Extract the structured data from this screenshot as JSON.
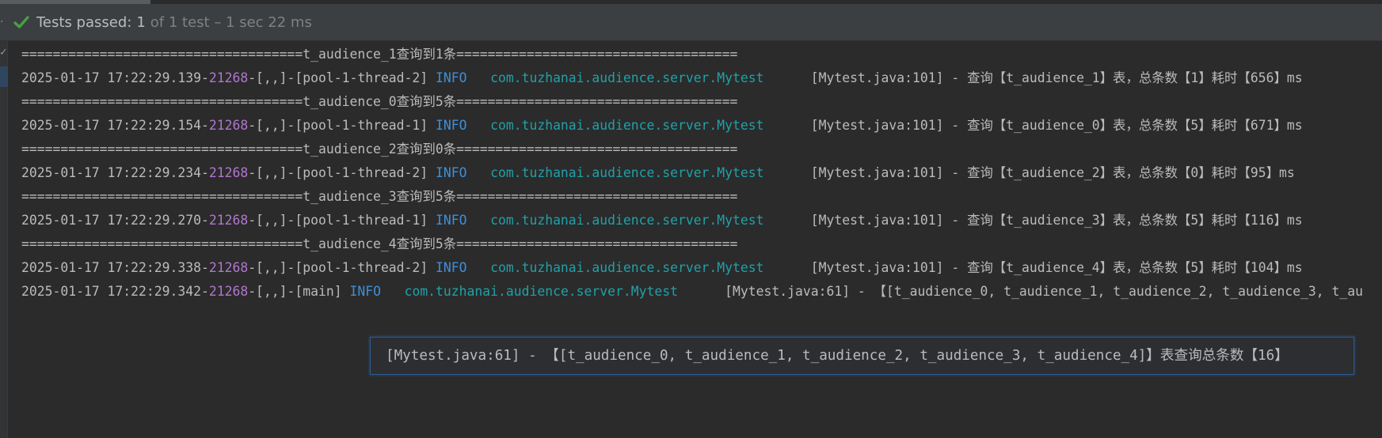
{
  "status": {
    "check_icon": "check-icon",
    "label": "Tests passed:",
    "count": "1",
    "rest": "of 1 test – 1 sec 22 ms",
    "colors": {
      "check": "#4a9e46",
      "bg": "#3c3f41"
    }
  },
  "colors": {
    "pid": "#b276d0",
    "info": "#3f8ed8",
    "class": "#1fa1a8",
    "text": "#bbbbbb",
    "tooltip_border": "#2c5a8e"
  },
  "console": {
    "lines": [
      {
        "type": "sep",
        "text": "====================================t_audience_1查询到1条===================================="
      },
      {
        "type": "log",
        "prefix": "2025-01-17 17:22:29.139-",
        "pid": "21268",
        "thread": "-[,,]-[pool-1-thread-2] ",
        "level": "INFO",
        "gap": "   ",
        "cls": "com.tuzhanai.audience.server.Mytest",
        "msg": "      [Mytest.java:101] - 查询【t_audience_1】表，总条数【1】耗时【656】ms"
      },
      {
        "type": "sep",
        "text": "====================================t_audience_0查询到5条===================================="
      },
      {
        "type": "log",
        "prefix": "2025-01-17 17:22:29.154-",
        "pid": "21268",
        "thread": "-[,,]-[pool-1-thread-1] ",
        "level": "INFO",
        "gap": "   ",
        "cls": "com.tuzhanai.audience.server.Mytest",
        "msg": "      [Mytest.java:101] - 查询【t_audience_0】表，总条数【5】耗时【671】ms"
      },
      {
        "type": "sep",
        "text": "====================================t_audience_2查询到0条===================================="
      },
      {
        "type": "log",
        "prefix": "2025-01-17 17:22:29.234-",
        "pid": "21268",
        "thread": "-[,,]-[pool-1-thread-2] ",
        "level": "INFO",
        "gap": "   ",
        "cls": "com.tuzhanai.audience.server.Mytest",
        "msg": "      [Mytest.java:101] - 查询【t_audience_2】表，总条数【0】耗时【95】ms"
      },
      {
        "type": "sep",
        "text": "====================================t_audience_3查询到5条===================================="
      },
      {
        "type": "log",
        "prefix": "2025-01-17 17:22:29.270-",
        "pid": "21268",
        "thread": "-[,,]-[pool-1-thread-1] ",
        "level": "INFO",
        "gap": "   ",
        "cls": "com.tuzhanai.audience.server.Mytest",
        "msg": "      [Mytest.java:101] - 查询【t_audience_3】表，总条数【5】耗时【116】ms"
      },
      {
        "type": "sep",
        "text": "====================================t_audience_4查询到5条===================================="
      },
      {
        "type": "log",
        "prefix": "2025-01-17 17:22:29.338-",
        "pid": "21268",
        "thread": "-[,,]-[pool-1-thread-2] ",
        "level": "INFO",
        "gap": "   ",
        "cls": "com.tuzhanai.audience.server.Mytest",
        "msg": "      [Mytest.java:101] - 查询【t_audience_4】表，总条数【5】耗时【104】ms"
      },
      {
        "type": "log",
        "prefix": "2025-01-17 17:22:29.342-",
        "pid": "21268",
        "thread": "-[,,]-[main] ",
        "level": "INFO",
        "gap": "   ",
        "cls": "com.tuzhanai.audience.server.Mytest",
        "msg": "      [Mytest.java:61] - 【[t_audience_0, t_audience_1, t_audience_2, t_audience_3, t_au"
      }
    ]
  },
  "tooltip": {
    "text": "[Mytest.java:61] - 【[t_audience_0, t_audience_1, t_audience_2, t_audience_3, t_audience_4]】表查询总条数【16】"
  }
}
